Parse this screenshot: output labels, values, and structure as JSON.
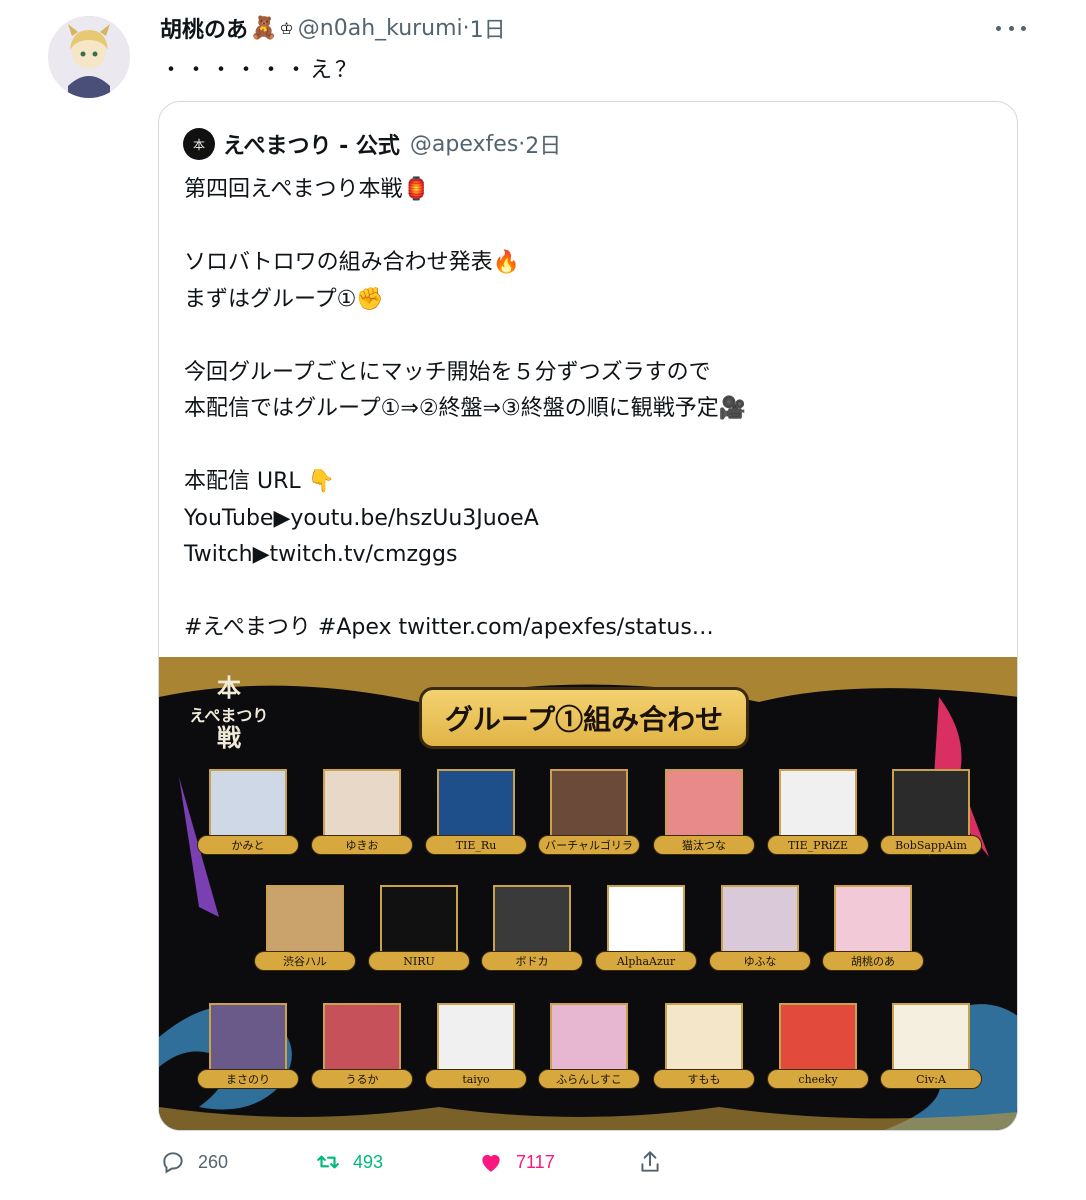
{
  "tweet": {
    "author_name": "胡桃のあ",
    "author_emoji": "🧸",
    "author_badge": "♔",
    "handle": "@n0ah_kurumi",
    "separator": "·",
    "time": "1日",
    "text": "・・・・・・え？"
  },
  "quote": {
    "avatar_text": "本",
    "author_name": "えぺまつり - 公式",
    "handle": "@apexfes",
    "separator": "·",
    "time": "2日",
    "lines": [
      "第四回えぺまつり本戦🏮",
      "",
      "ソロバトロワの組み合わせ発表🔥",
      "まずはグループ①✊",
      "",
      "今回グループごとにマッチ開始を５分ずつズラすので",
      "本配信ではグループ①⇒②終盤⇒③終盤の順に観戦予定🎥",
      "",
      "本配信 URL 👇",
      "YouTube▶youtu.be/hszUu3JuoeA",
      "Twitch▶twitch.tv/cmzggs",
      "",
      "#えぺまつり #Apex twitter.com/apexfes/status…"
    ],
    "image": {
      "logo_text": "本\nえぺまつり\n戦",
      "banner": "グループ①組み合わせ",
      "rows": [
        [
          "かみと",
          "ゆきお",
          "TIE_Ru",
          "バーチャルゴリラ",
          "猫汰つな",
          "TIE_PRiZE",
          "BobSappAim"
        ],
        [
          "渋谷ハル",
          "NIRU",
          "ボドカ",
          "AlphaAzur",
          "ゆふな",
          "胡桃のあ"
        ],
        [
          "まさのり",
          "うるか",
          "taiyo",
          "ふらんしすこ",
          "すもも",
          "cheeky",
          "Civ:A"
        ]
      ]
    }
  },
  "actions": {
    "replies": "260",
    "retweets": "493",
    "likes": "7117"
  },
  "colors": {
    "text": "#0f1419",
    "secondary": "#536471",
    "retweet": "#00ba7c",
    "like": "#f91880",
    "gold": "#d6a83e"
  }
}
